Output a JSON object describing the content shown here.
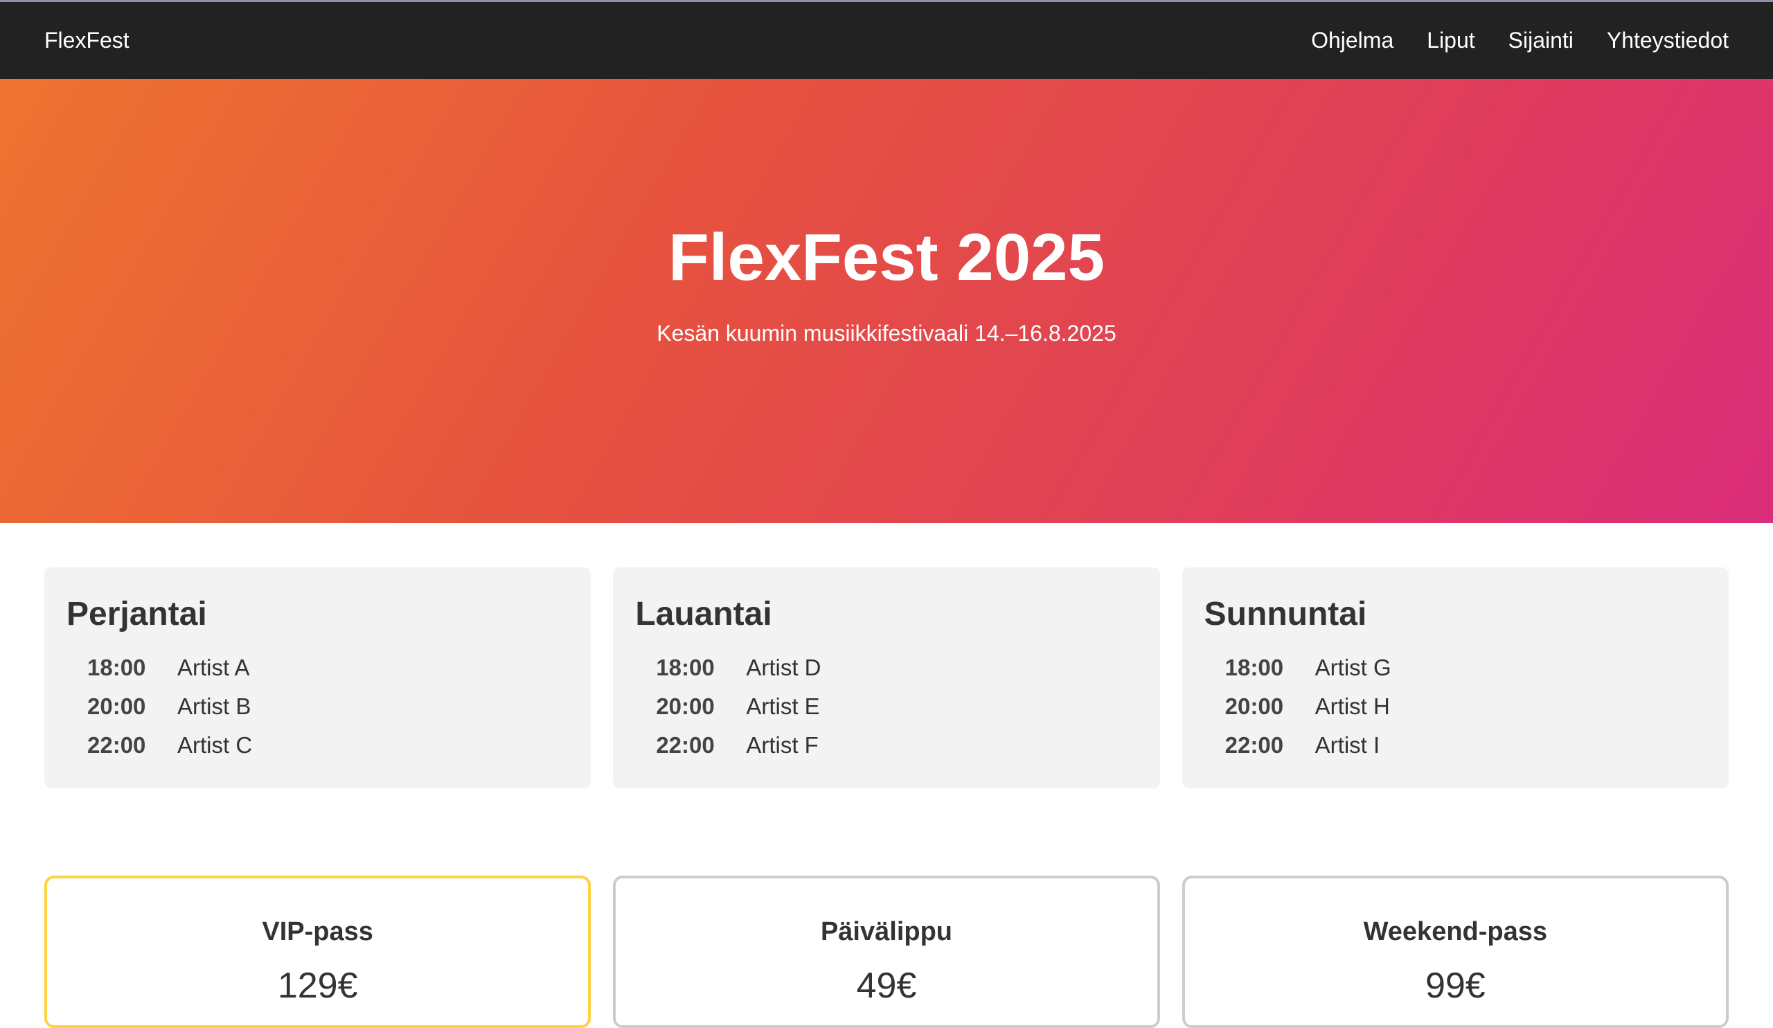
{
  "nav": {
    "brand": "FlexFest",
    "links": [
      "Ohjelma",
      "Liput",
      "Sijainti",
      "Yhteystiedot"
    ]
  },
  "hero": {
    "title": "FlexFest 2025",
    "subtitle": "Kesän kuumin musiikkifestivaali 14.–16.8.2025"
  },
  "schedule": [
    {
      "day": "Perjantai",
      "slots": [
        {
          "time": "18:00",
          "artist": "Artist A"
        },
        {
          "time": "20:00",
          "artist": "Artist B"
        },
        {
          "time": "22:00",
          "artist": "Artist C"
        }
      ]
    },
    {
      "day": "Lauantai",
      "slots": [
        {
          "time": "18:00",
          "artist": "Artist D"
        },
        {
          "time": "20:00",
          "artist": "Artist E"
        },
        {
          "time": "22:00",
          "artist": "Artist F"
        }
      ]
    },
    {
      "day": "Sunnuntai",
      "slots": [
        {
          "time": "18:00",
          "artist": "Artist G"
        },
        {
          "time": "20:00",
          "artist": "Artist H"
        },
        {
          "time": "22:00",
          "artist": "Artist I"
        }
      ]
    }
  ],
  "tickets": [
    {
      "name": "VIP-pass",
      "price": "129€",
      "featured": true
    },
    {
      "name": "Päivälippu",
      "price": "49€",
      "featured": false
    },
    {
      "name": "Weekend-pass",
      "price": "99€",
      "featured": false
    }
  ],
  "colors": {
    "nav_bg": "#222222",
    "hero_gradient_start": "#ee7430",
    "hero_gradient_end": "#db2d7a",
    "card_bg": "#f3f3f3",
    "featured_border": "#ffd23f",
    "ticket_border": "#cccccc"
  }
}
